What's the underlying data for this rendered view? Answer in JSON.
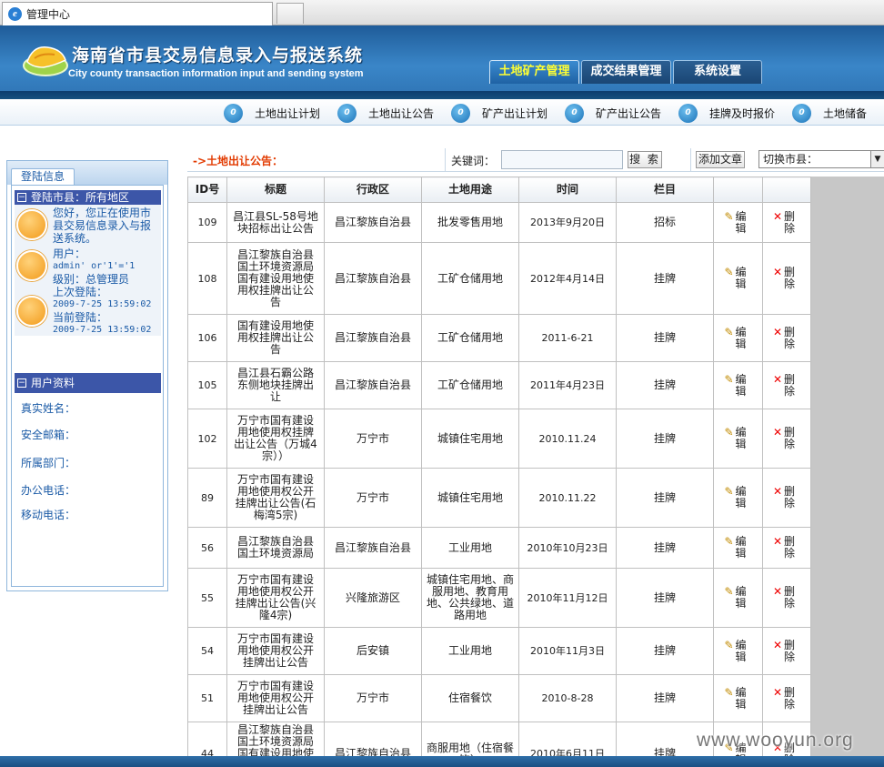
{
  "browser": {
    "tab_title": "管理中心",
    "tab_icon": "ie-icon"
  },
  "header": {
    "title_cn": "海南省市县交易信息录入与报送系统",
    "title_en": "City county transaction information input and sending system",
    "tabs": [
      {
        "label": "土地矿产管理",
        "active": true
      },
      {
        "label": "成交结果管理",
        "active": false
      },
      {
        "label": "系统设置",
        "active": false
      }
    ]
  },
  "subnav": {
    "items": [
      {
        "label": "土地出让计划"
      },
      {
        "label": "土地出让公告"
      },
      {
        "label": "矿产出让计划"
      },
      {
        "label": "矿产出让公告"
      },
      {
        "label": "挂牌及时报价"
      },
      {
        "label": "土地储备"
      }
    ]
  },
  "sidebar": {
    "tab_label": "登陆信息",
    "login_section_title": "登陆市县：所有地区",
    "welcome": "您好，您正在使用市县交易信息录入与报送系统。",
    "user_label": "用户：",
    "user_value": "admin' or'1'='1",
    "level": "级别：总管理员",
    "last_login_label": "上次登陆：",
    "last_login_time": "2009-7-25 13:59:02",
    "current_login_label": "当前登陆：",
    "current_login_time": "2009-7-25 13:59:02",
    "profile_section_title": "用户资料",
    "profile_fields": [
      "真实姓名：",
      "安全邮箱：",
      "所属部门：",
      "办公电话：",
      "移动电话："
    ]
  },
  "toolbar": {
    "section_title": "->土地出让公告：",
    "keyword_label": "关键词：",
    "keyword_value": "",
    "search_label": "搜 索",
    "add_label": "添加文章",
    "city_label": "切换市县："
  },
  "table": {
    "columns": [
      "ID号",
      "标题",
      "行政区",
      "土地用途",
      "时间",
      "栏目",
      "",
      ""
    ],
    "edit_label": "编辑",
    "delete_label": "删除",
    "rows": [
      {
        "id": "109",
        "title": "昌江县SL-58号地块招标出让公告",
        "district": "昌江黎族自治县",
        "usage": "批发零售用地",
        "time": "2013年9月20日",
        "column": "招标"
      },
      {
        "id": "108",
        "title": "昌江黎族自治县国土环境资源局国有建设用地使用权挂牌出让公告",
        "district": "昌江黎族自治县",
        "usage": "工矿仓储用地",
        "time": "2012年4月14日",
        "column": "挂牌"
      },
      {
        "id": "106",
        "title": "国有建设用地使用权挂牌出让公告",
        "district": "昌江黎族自治县",
        "usage": "工矿仓储用地",
        "time": "2011-6-21",
        "column": "挂牌"
      },
      {
        "id": "105",
        "title": "昌江县石霸公路东侧地块挂牌出让",
        "district": "昌江黎族自治县",
        "usage": "工矿仓储用地",
        "time": "2011年4月23日",
        "column": "挂牌"
      },
      {
        "id": "102",
        "title": "万宁市国有建设用地使用权挂牌出让公告（万城4宗））",
        "district": "万宁市",
        "usage": "城镇住宅用地",
        "time": "2010.11.24",
        "column": "挂牌"
      },
      {
        "id": "89",
        "title": "万宁市国有建设用地使用权公开挂牌出让公告(石梅湾5宗)",
        "district": "万宁市",
        "usage": "城镇住宅用地",
        "time": "2010.11.22",
        "column": "挂牌"
      },
      {
        "id": "56",
        "title": "昌江黎族自治县国土环境资源局",
        "district": "昌江黎族自治县",
        "usage": "工业用地",
        "time": "2010年10月23日",
        "column": "挂牌"
      },
      {
        "id": "55",
        "title": "万宁市国有建设用地使用权公开挂牌出让公告(兴隆4宗)",
        "district": "兴隆旅游区",
        "usage": "城镇住宅用地、商服用地、教育用地、公共绿地、道路用地",
        "time": "2010年11月12日",
        "column": "挂牌"
      },
      {
        "id": "54",
        "title": "万宁市国有建设用地使用权公开挂牌出让公告",
        "district": "后安镇",
        "usage": "工业用地",
        "time": "2010年11月3日",
        "column": "挂牌"
      },
      {
        "id": "51",
        "title": "万宁市国有建设用地使用权公开挂牌出让公告",
        "district": "万宁市",
        "usage": "住宿餐饮",
        "time": "2010-8-28",
        "column": "挂牌"
      },
      {
        "id": "44",
        "title": "昌江黎族自治县国土环境资源局国有建设用地使用权挂牌出让公告",
        "district": "昌江黎族自治县",
        "usage": "商服用地（住宿餐饮）",
        "time": "2010年6月11日",
        "column": "挂牌"
      }
    ]
  },
  "watermark": "www.wooyun.org"
}
